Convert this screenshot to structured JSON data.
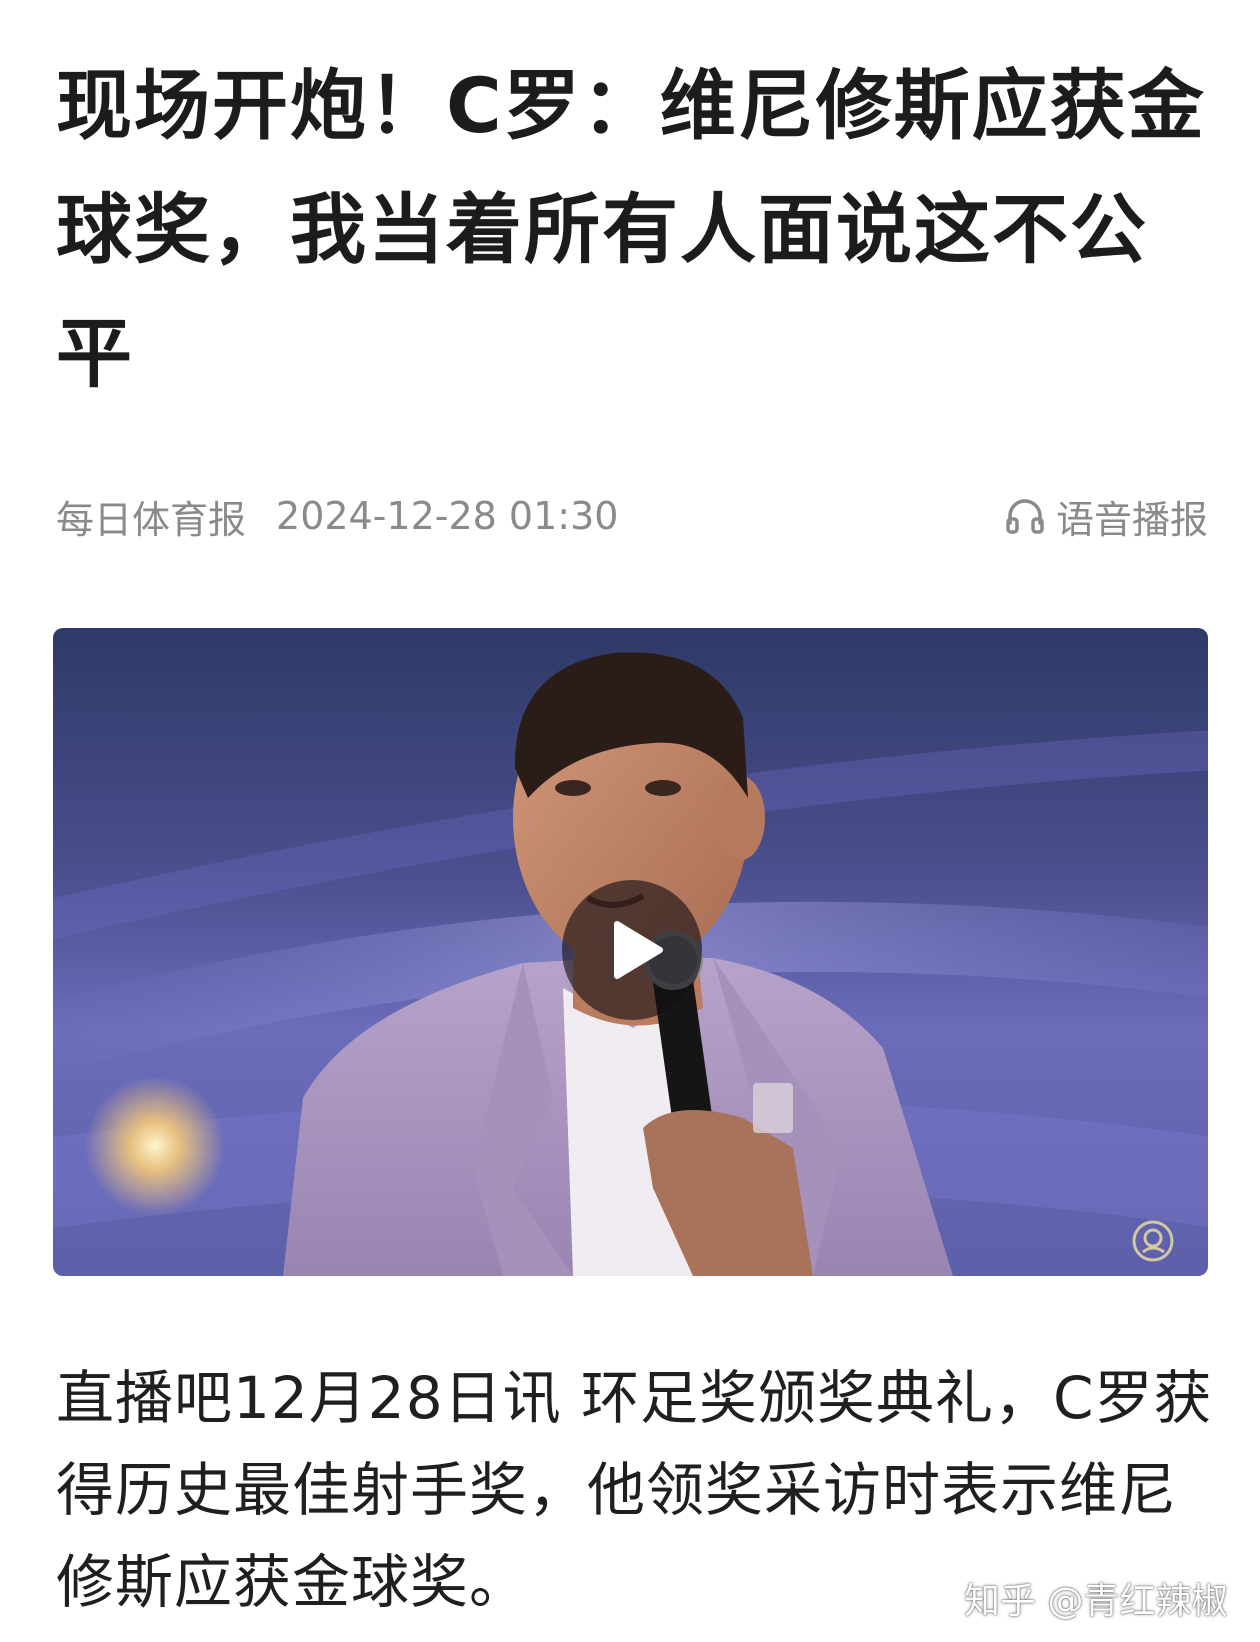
{
  "article": {
    "title": "现场开炮！C罗：维尼修斯应获金球奖，我当着所有人面说这不公平",
    "source": "每日体育报",
    "timestamp": "2024-12-28 01:30",
    "tts_label": "语音播报",
    "tts_icon": "headphones-icon",
    "body": "直播吧12月28日讯 环足奖颁奖典礼，C罗获得历史最佳射手奖，他领奖采访时表示维尼修斯应获金球奖。"
  },
  "video": {
    "play_icon": "play-icon",
    "corner_logo_icon": "broadcaster-logo-icon"
  },
  "watermark": {
    "text": "知乎 @青红辣椒"
  }
}
